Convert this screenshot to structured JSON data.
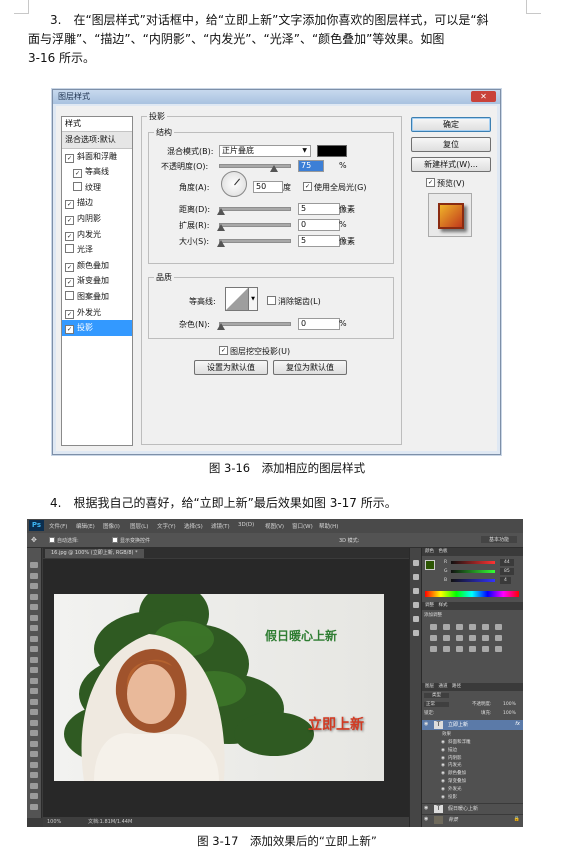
{
  "page": {
    "para3": {
      "line1": "3.　在“图层样式”对话框中，给“立即上新”文字添加你喜欢的图层样式，可以是“斜",
      "line2": "面与浮雕”、“描边”、“内阴影”、“内发光”、“光泽”、“颜色叠加”等效果。如图",
      "line3": "3-16 所示。"
    },
    "caption1": "图 3-16　添加相应的图层样式",
    "para4": "4.　根据我自己的喜好，给“立即上新”最后效果如图 3-17 所示。",
    "caption2": "图 3-17　添加效果后的“立即上新”"
  },
  "dialog": {
    "title": "图层样式",
    "close": "✕",
    "styles_header": "样式",
    "blend_options": "混合选项:默认",
    "styles": [
      {
        "label": "斜面和浮雕",
        "checked": true,
        "sub": false,
        "selected": false
      },
      {
        "label": "等高线",
        "checked": true,
        "sub": true,
        "selected": false
      },
      {
        "label": "纹理",
        "checked": false,
        "sub": true,
        "selected": false
      },
      {
        "label": "描边",
        "checked": true,
        "sub": false,
        "selected": false
      },
      {
        "label": "内阴影",
        "checked": true,
        "sub": false,
        "selected": false
      },
      {
        "label": "内发光",
        "checked": true,
        "sub": false,
        "selected": false
      },
      {
        "label": "光泽",
        "checked": false,
        "sub": false,
        "selected": false
      },
      {
        "label": "颜色叠加",
        "checked": true,
        "sub": false,
        "selected": false
      },
      {
        "label": "渐变叠加",
        "checked": true,
        "sub": false,
        "selected": false
      },
      {
        "label": "图案叠加",
        "checked": false,
        "sub": false,
        "selected": false
      },
      {
        "label": "外发光",
        "checked": true,
        "sub": false,
        "selected": false
      },
      {
        "label": "投影",
        "checked": true,
        "sub": false,
        "selected": true
      }
    ],
    "section_title": "投影",
    "structure": {
      "group_label": "结构",
      "blend_mode_label": "混合模式(B):",
      "blend_mode_value": "正片叠底",
      "opacity_label": "不透明度(O):",
      "opacity_value": "75",
      "percent": "%",
      "angle_label": "角度(A):",
      "angle_value": "50",
      "degree": "度",
      "global_light_label": "使用全局光(G)",
      "distance_label": "距离(D):",
      "distance_value": "5",
      "spread_label": "扩展(R):",
      "spread_value": "0",
      "size_label": "大小(S):",
      "size_value": "5",
      "pixels": "像素"
    },
    "quality": {
      "group_label": "品质",
      "contour_label": "等高线:",
      "antialias_label": "消除锯齿(L)",
      "noise_label": "杂色(N):",
      "noise_value": "0",
      "percent": "%"
    },
    "knockout_label": "图层挖空投影(U)",
    "set_default": "设置为默认值",
    "reset_default": "复位为默认值",
    "ok": "确定",
    "reset": "复位",
    "new_style": "新建样式(W)...",
    "preview": "预览(V)",
    "shadow_color": "#000000"
  },
  "photoshop": {
    "logo": "Ps",
    "menus": [
      "文件(F)",
      "编辑(E)",
      "图像(I)",
      "图层(L)",
      "文字(Y)",
      "选择(S)",
      "滤镜(T)",
      "3D(D)",
      "视图(V)",
      "窗口(W)",
      "帮助(H)"
    ],
    "auto_select": "自动选择:",
    "show_transform": "显示变换控件",
    "mode_3d": "3D 模式:",
    "workspace": "基本功能",
    "doc_tab": "16.jpg @ 100% (立即上新, RGB/8) *",
    "zoom": "100%",
    "doc_info": "文档:1.81M/1.44M",
    "text_top": "假日暖心上新",
    "text_main": "立即上新",
    "text_top_color": "#2e7d32",
    "text_main_color": "#d23a22",
    "color_panel_tabs": "颜色　色板",
    "rgb": [
      {
        "ch": "R",
        "value": "44"
      },
      {
        "ch": "G",
        "value": "85"
      },
      {
        "ch": "B",
        "value": "4"
      }
    ],
    "adjust_tabs": "调整　样式",
    "adjust_add": "添加调整",
    "layers_tabs": "图层　通道　路径",
    "kind": "类型",
    "blend": "正常",
    "opacity_label": "不透明度:",
    "opacity": "100%",
    "lock_label": "锁定:",
    "fill_label": "填充:",
    "fill": "100%",
    "text_layer": "立即上新",
    "effects": "效果",
    "effect_items": [
      "斜面和浮雕",
      "描边",
      "内阴影",
      "内发光",
      "颜色叠加",
      "渐变叠加",
      "外发光",
      "投影"
    ],
    "second_text_layer": "假日暖心上新",
    "bg_layer": "背景"
  }
}
